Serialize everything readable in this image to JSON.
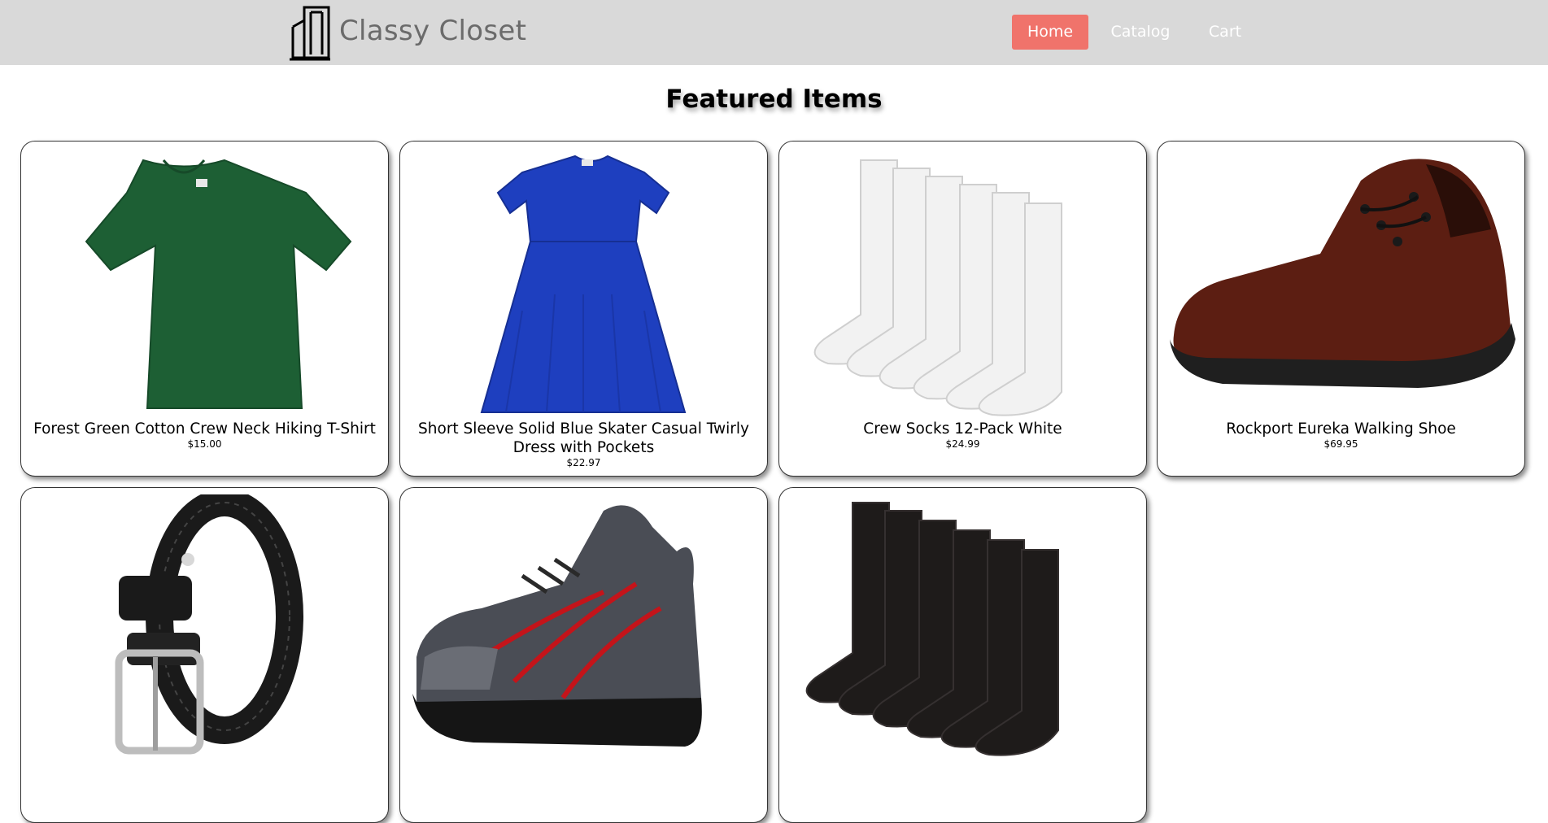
{
  "nav": {
    "brand": "Classy Closet",
    "links": [
      {
        "label": "Home",
        "active": true
      },
      {
        "label": "Catalog",
        "active": false
      },
      {
        "label": "Cart",
        "active": false
      }
    ],
    "active_color": "#f0736b",
    "bar_color": "#d9d9d9"
  },
  "page_title": "Featured Items",
  "products": [
    {
      "name": "Forest Green Cotton Crew Neck Hiking T-Shirt",
      "price": "$15.00",
      "icon": "green-tshirt-image"
    },
    {
      "name": "Short Sleeve Solid Blue Skater Casual Twirly Dress with Pockets",
      "price": "$22.97",
      "icon": "blue-dress-image"
    },
    {
      "name": "Crew Socks 12-Pack White",
      "price": "$24.99",
      "icon": "white-socks-image"
    },
    {
      "name": "Rockport Eureka Walking Shoe",
      "price": "$69.95",
      "icon": "brown-shoe-image"
    },
    {
      "name": "",
      "price": "",
      "icon": "black-braided-belt-image"
    },
    {
      "name": "",
      "price": "",
      "icon": "gray-red-sneaker-image"
    },
    {
      "name": "",
      "price": "",
      "icon": "black-socks-image"
    }
  ]
}
